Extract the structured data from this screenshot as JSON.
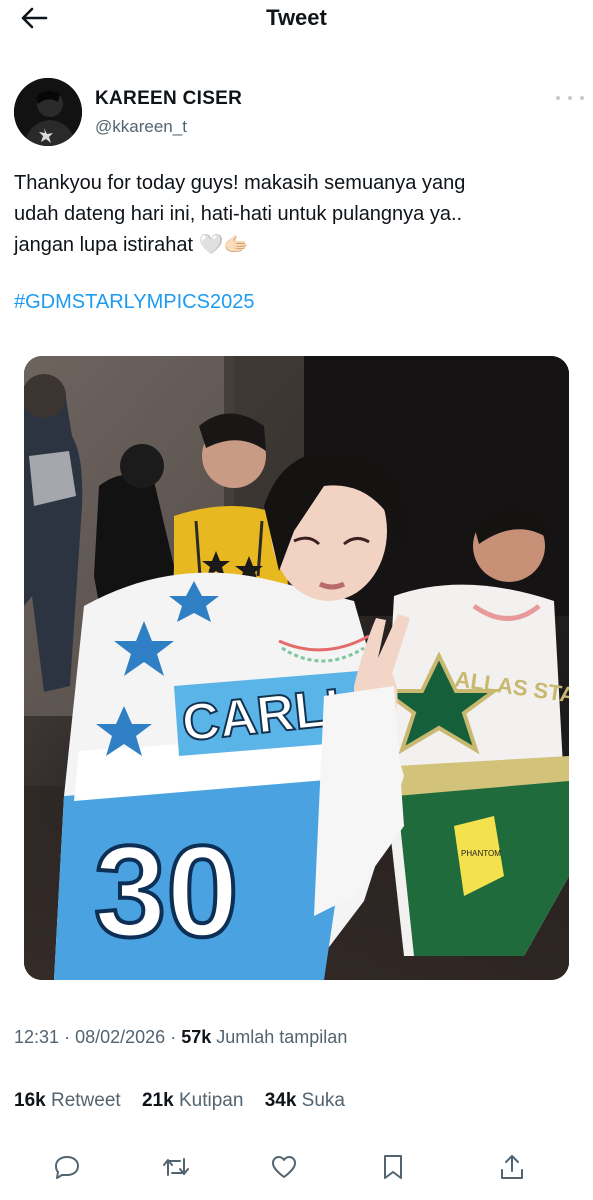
{
  "header": {
    "title": "Tweet",
    "back_icon": "arrow-left-icon"
  },
  "author": {
    "name": "KAREEN CISER",
    "handle": "@kkareen_t",
    "more_icon": "more-horizontal-icon"
  },
  "tweet": {
    "lines": [
      "Thankyou for today guys! makasih semuanya yang",
      "udah dateng hari ini, hati-hati untuk pulangnya ya..",
      "jangan lupa istirahat 🤍🫱🏻"
    ],
    "hashtag": "#GDMSTARLYMPICS2025",
    "accent_color": "#1d9bf0"
  },
  "meta": {
    "time": "12:31",
    "date": "08/02/2026",
    "separator": "·",
    "views_count": "57k",
    "views_label": "Jumlah tampilan"
  },
  "stats": [
    {
      "count": "16k",
      "label": "Retweet"
    },
    {
      "count": "21k",
      "label": "Kutipan"
    },
    {
      "count": "34k",
      "label": "Suka"
    }
  ],
  "photo": {
    "jersey_front_text": "CARLI",
    "jersey_number": "30",
    "jersey_right_text": "ALLAS STARS",
    "glove_text": "PHANTOM"
  },
  "actions": [
    "reply-icon",
    "retweet-icon",
    "like-icon",
    "bookmark-icon",
    "share-icon"
  ]
}
